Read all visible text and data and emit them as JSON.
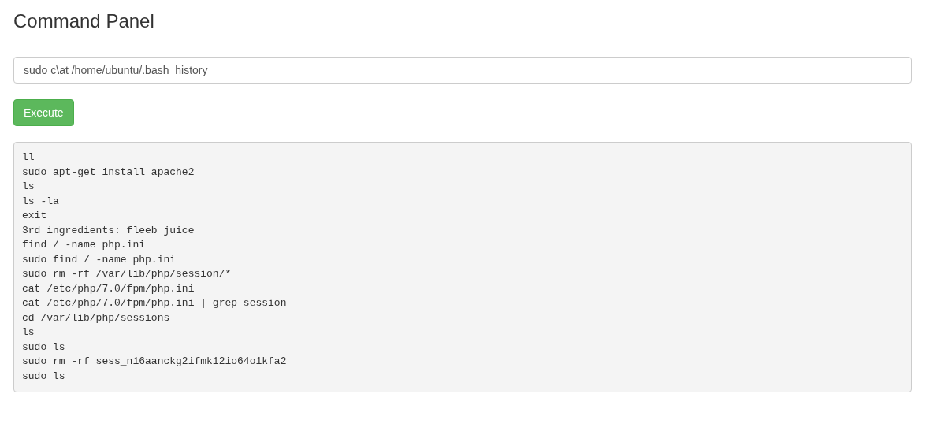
{
  "title": "Command Panel",
  "command_field": {
    "value": "sudo c\\at /home/ubuntu/.bash_history"
  },
  "execute_button": {
    "label": "Execute"
  },
  "output_lines": [
    "ll",
    "sudo apt-get install apache2",
    "ls",
    "ls -la",
    "exit",
    "3rd ingredients: fleeb juice",
    "find / -name php.ini",
    "sudo find / -name php.ini",
    "sudo rm -rf /var/lib/php/session/*",
    "cat /etc/php/7.0/fpm/php.ini",
    "cat /etc/php/7.0/fpm/php.ini | grep session",
    "cd /var/lib/php/sessions",
    "ls",
    "sudo ls",
    "sudo rm -rf sess_n16aanckg2ifmk12io64o1kfa2",
    "sudo ls"
  ]
}
